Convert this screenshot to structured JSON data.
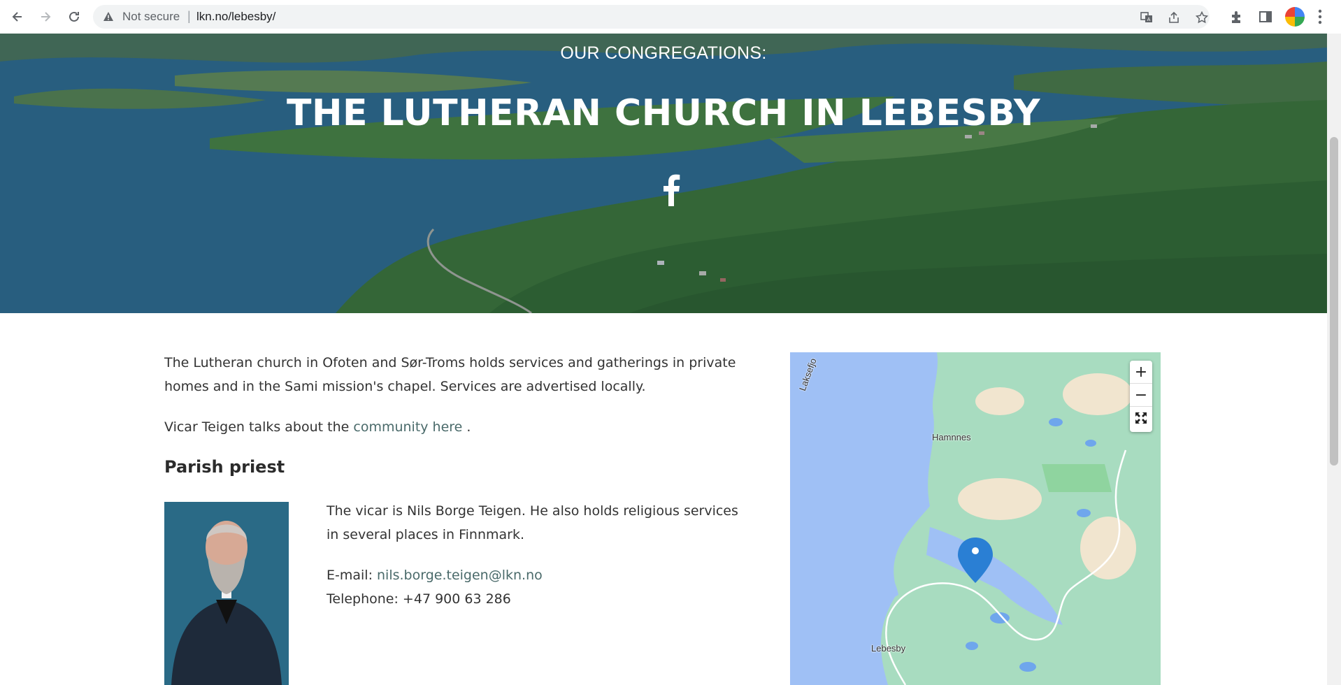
{
  "browser": {
    "security_label": "Not secure",
    "separator": "|",
    "url": "lkn.no/lebesby/"
  },
  "hero": {
    "kicker": "OUR CONGREGATIONS:",
    "title": "THE LUTHERAN CHURCH IN LEBESBY"
  },
  "content": {
    "intro": "The Lutheran church in Ofoten and Sør-Troms holds services and gatherings in private homes and in the Sami mission's chapel. Services are advertised locally.",
    "community_prefix": "Vicar Teigen talks about the ",
    "community_link": "community here",
    "community_suffix": " .",
    "priest_heading": "Parish priest",
    "bio": "The vicar is Nils Borge Teigen. He also holds religious services in several places in Finnmark.",
    "email_label": "E-mail: ",
    "email": "nils.borge.teigen@lkn.no",
    "phone": "Telephone: +47 900 63 286"
  },
  "map": {
    "zoom_in": "+",
    "zoom_out": "−",
    "labels": {
      "hamnnes": "Hamnnes",
      "lebesby": "Lebesby",
      "laksefjord": "Laksefjo"
    }
  },
  "colors": {
    "link": "#4a6a6a",
    "hero_overlay": "#2f6a88",
    "map_water": "#9fc0f5",
    "map_land": "#a8dcc0"
  }
}
